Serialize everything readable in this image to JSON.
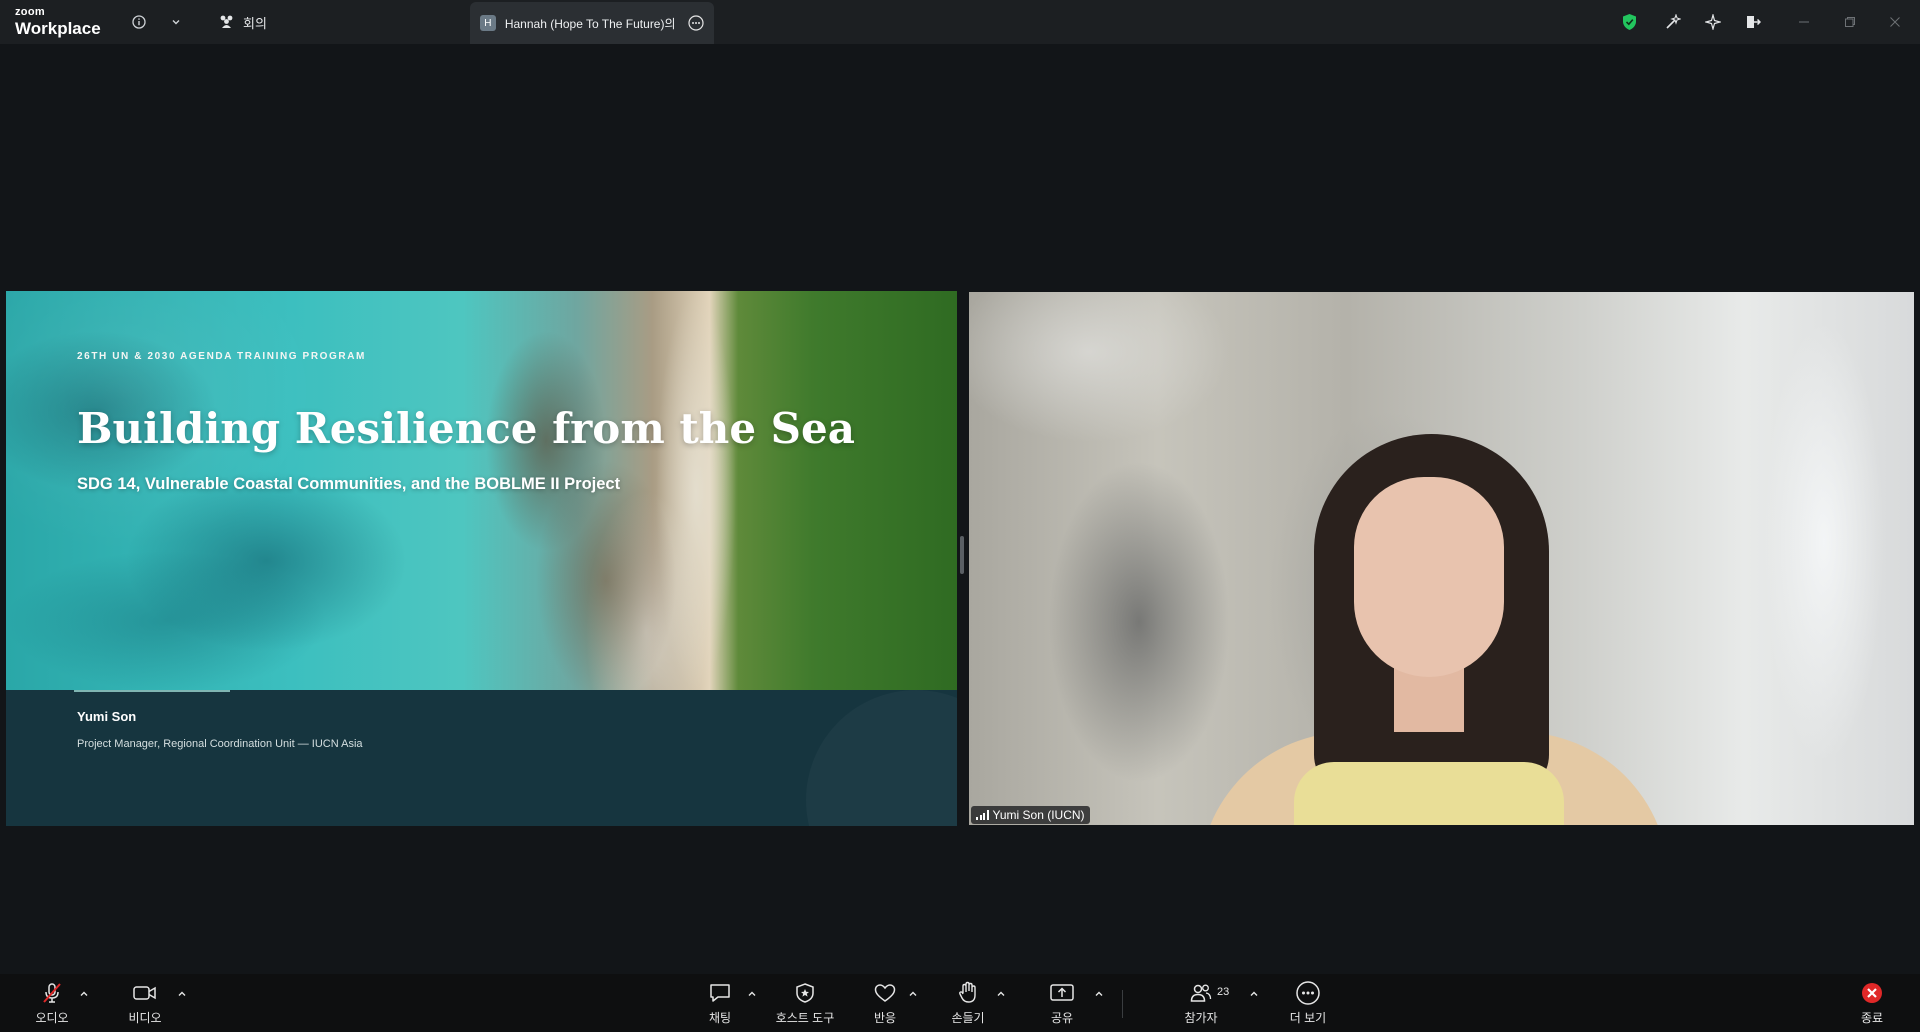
{
  "app": {
    "logo_small": "zoom",
    "logo_large": "Workplace"
  },
  "titlebar": {
    "meeting_label": "회의",
    "tab_avatar_letter": "H",
    "tab_title": "Hannah (Hope To The Future)의 화면",
    "icons": [
      "info-icon",
      "chevron-down-icon",
      "meeting-icon",
      "more-icon",
      "shield-check-icon",
      "wand-icon",
      "sparkle-icon",
      "leave-icon",
      "minimize-icon",
      "maximize-icon",
      "close-icon"
    ],
    "security_color": "#22c55e"
  },
  "slide": {
    "kicker": "26TH UN & 2030 AGENDA TRAINING PROGRAM",
    "title": "Building Resilience from the Sea",
    "subtitle": "SDG 14, Vulnerable Coastal Communities, and the BOBLME II Project",
    "presenter": "Yumi Son",
    "role": "Project Manager, Regional Coordination Unit — IUCN Asia"
  },
  "video": {
    "name_tag": "Yumi Son (IUCN)"
  },
  "toolbar": {
    "audio": "오디오",
    "video": "비디오",
    "chat": "채팅",
    "host_tools": "호스트 도구",
    "reactions": "반응",
    "raise_hand": "손들기",
    "share": "공유",
    "participants": "참가자",
    "participants_count": "23",
    "more": "더 보기",
    "end": "종료",
    "end_color": "#e02828"
  }
}
